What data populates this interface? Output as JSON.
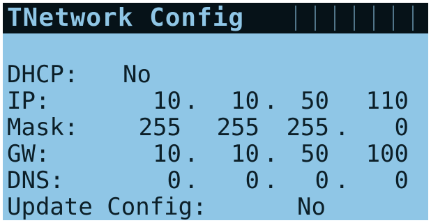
{
  "title": "TNetwork Config",
  "dhcp": {
    "label": "DHCP:",
    "value": "No"
  },
  "ip": {
    "label": "IP:",
    "octets": [
      "10",
      "10",
      "50",
      "110"
    ]
  },
  "mask": {
    "label": "Mask:",
    "octets": [
      "255",
      "255",
      "255",
      "0"
    ]
  },
  "gw": {
    "label": "GW:",
    "octets": [
      "10",
      "10",
      "50",
      "100"
    ]
  },
  "dns": {
    "label": "DNS:",
    "octets": [
      "0",
      "0",
      "0",
      "0"
    ]
  },
  "update": {
    "label": "Update Config:",
    "value": "No"
  },
  "colors": {
    "background": "#8fc6e6",
    "foreground": "#0c1f28",
    "title_bar": "#061218"
  }
}
